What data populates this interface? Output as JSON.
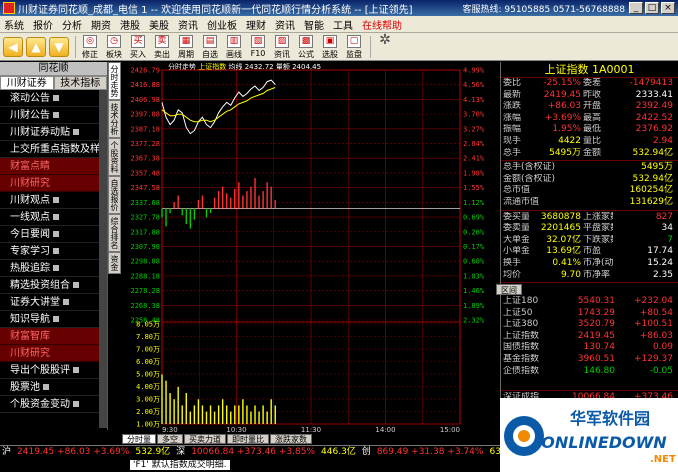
{
  "window": {
    "title": "川财证券同花顺_成都_电信 1 -- 欢迎使用同花顺新一代同花顺行情分析系统 -- [上证领先]",
    "phone": "客服热线: 95105885 0571-56768888"
  },
  "menu": [
    "系统",
    "报价",
    "分析",
    "期资",
    "港股",
    "美股",
    "资讯",
    "创业板",
    "理财",
    "资讯",
    "智能",
    "工具",
    "在线帮助"
  ],
  "toolbar": [
    {
      "icon": "◎",
      "label": "修正"
    },
    {
      "icon": "◷",
      "label": "板块"
    },
    {
      "icon": "买",
      "label": "买入"
    },
    {
      "icon": "卖",
      "label": "卖出"
    },
    {
      "icon": "▦",
      "label": "周期"
    },
    {
      "icon": "▤",
      "label": "自选"
    },
    {
      "icon": "▥",
      "label": "画线"
    },
    {
      "icon": "▧",
      "label": "F10"
    },
    {
      "icon": "▨",
      "label": "资讯"
    },
    {
      "icon": "▩",
      "label": "公式"
    },
    {
      "icon": "▣",
      "label": "选股"
    },
    {
      "icon": "▢",
      "label": "监盘"
    }
  ],
  "left": {
    "header": "同花顺",
    "tabs": [
      "川财证券",
      "技术指标"
    ],
    "items": [
      {
        "text": "滚动公告",
        "dot": true
      },
      {
        "text": "川财公告",
        "dot": true
      },
      {
        "text": "川财证券动贴",
        "dot": true
      },
      {
        "text": "上交所重点指数及样本",
        "dot": false
      }
    ],
    "section1": "财富点睛",
    "section1b": "川财研究",
    "items2": [
      {
        "text": "川财观点",
        "dot": true
      },
      {
        "text": "一线观点",
        "dot": true
      },
      {
        "text": "今日要闻",
        "dot": true
      },
      {
        "text": "专家学习",
        "dot": true
      },
      {
        "text": "热股追踪",
        "dot": true
      },
      {
        "text": "精选投资组合",
        "dot": true
      },
      {
        "text": "证券大讲堂",
        "dot": true
      },
      {
        "text": "知识导航",
        "dot": true
      }
    ],
    "section2": "财富智库",
    "section2b": "川财研究",
    "items3": [
      {
        "text": "导出个股股评",
        "dot": true
      },
      {
        "text": "股票池",
        "dot": true
      },
      {
        "text": "个股资金变动",
        "dot": true
      }
    ]
  },
  "vtabs": [
    "分时走势",
    "技术分析",
    "个股资料",
    "自选报价",
    "综合排名",
    "资金"
  ],
  "chart_data": {
    "type": "line",
    "title": "",
    "header_text": {
      "label": "分时走势",
      "name": "上证指数",
      "price_label": "均线",
      "price": "2432.72",
      "vol_label": "量额",
      "vol": "2404.45"
    },
    "y_ticks_left": [
      "2426.79",
      "2416.88",
      "2406.98",
      "2397.08",
      "2387.18",
      "2377.28",
      "2367.38",
      "2357.48",
      "2347.58",
      "2337.68",
      "2327.78",
      "2317.88",
      "2307.98",
      "2298.08",
      "2288.18",
      "2278.28",
      "2268.38",
      "2258.48"
    ],
    "y_ticks_vol": [
      "8.05万",
      "7.80万",
      "7.00万",
      "6.00万",
      "5.00万",
      "4.00万",
      "3.00万",
      "2.00万",
      "1.00万"
    ],
    "y_ticks_pct": [
      "4.99%",
      "4.56%",
      "4.13%",
      "3.70%",
      "3.27%",
      "2.84%",
      "2.41%",
      "1.98%",
      "1.55%",
      "1.12%",
      "0.69%",
      "0.26%",
      "0.17%",
      "0.60%",
      "1.03%",
      "1.46%",
      "1.89%",
      "2.32%"
    ],
    "x_labels": [
      "9:30",
      "10:30",
      "11:30",
      "14:00",
      "15:00"
    ],
    "base": 2333.41,
    "series": [
      {
        "name": "",
        "x": [
          0,
          1,
          2,
          3,
          4,
          5,
          6,
          7,
          8,
          9,
          10,
          11,
          12,
          13,
          14,
          15,
          16,
          17,
          18,
          19,
          20,
          21,
          22,
          23,
          24,
          25,
          26,
          27,
          28
        ],
        "values": [
          2405,
          2395,
          2390,
          2393,
          2400,
          2398,
          2388,
          2384,
          2386,
          2392,
          2395,
          2390,
          2388,
          2392,
          2398,
          2402,
          2405,
          2403,
          2408,
          2412,
          2409,
          2411,
          2414,
          2416,
          2413,
          2415,
          2419,
          2420,
          2417
        ]
      },
      {
        "name": "",
        "x": [
          0,
          1,
          2,
          3,
          4,
          5,
          6,
          7,
          8,
          9,
          10,
          11,
          12,
          13,
          14,
          15,
          16,
          17,
          18,
          19,
          20,
          21,
          22,
          23,
          24,
          25,
          26,
          27,
          28
        ],
        "values": [
          2400,
          2398,
          2396,
          2396,
          2397,
          2397,
          2395,
          2393,
          2392,
          2392,
          2393,
          2393,
          2392,
          2393,
          2395,
          2397,
          2399,
          2400,
          2402,
          2404,
          2405,
          2406,
          2408,
          2409,
          2410,
          2411,
          2413,
          2414,
          2415
        ]
      }
    ],
    "bars_updown": [
      -4,
      -8,
      -2,
      3,
      6,
      -3,
      -7,
      -9,
      -5,
      4,
      6,
      -4,
      -2,
      5,
      8,
      10,
      7,
      5,
      9,
      12,
      6,
      8,
      10,
      14,
      6,
      8,
      12,
      10,
      4
    ],
    "volume": [
      8,
      7,
      5,
      4,
      6,
      3,
      5,
      2,
      3,
      4,
      3,
      2,
      3,
      2,
      3,
      4,
      3,
      2,
      3,
      3,
      4,
      3,
      2,
      3,
      2,
      3,
      2,
      4,
      3
    ]
  },
  "right": {
    "title": "上证指数 1A0001",
    "rows": [
      {
        "a": "委比",
        "b": "-25.15%",
        "bc": "r",
        "c": "委差",
        "d": "-1479413",
        "dc": "r"
      },
      {
        "a": "最新",
        "b": "2419.45",
        "bc": "r",
        "c": "昨收",
        "d": "2333.41",
        "dc": "w"
      },
      {
        "a": "涨跌",
        "b": "+86.03",
        "bc": "r",
        "c": "开盘",
        "d": "2392.49",
        "dc": "r"
      },
      {
        "a": "涨幅",
        "b": "+3.69%",
        "bc": "r",
        "c": "最高",
        "d": "2422.52",
        "dc": "r"
      },
      {
        "a": "振幅",
        "b": "1.95%",
        "bc": "r",
        "c": "最低",
        "d": "2376.92",
        "dc": "r"
      },
      {
        "a": "现手",
        "b": "4422",
        "bc": "y",
        "c": "量比",
        "d": "2.94",
        "dc": "r"
      },
      {
        "a": "总手",
        "b": "5495万",
        "bc": "y",
        "c": "金额",
        "d": "532.94亿",
        "dc": "y"
      }
    ],
    "rows_b": [
      {
        "a": "总手(含权证)",
        "b": "",
        "c": "5495万",
        "cc": "y"
      },
      {
        "a": "金额(含权证)",
        "b": "",
        "c": "532.94亿",
        "cc": "y"
      },
      {
        "a": "总市值",
        "b": "",
        "c": "160254亿",
        "cc": "y"
      },
      {
        "a": "流通市值",
        "b": "",
        "c": "131629亿",
        "cc": "y"
      }
    ],
    "rows_c": [
      {
        "a": "委买量",
        "b": "3680878",
        "bc": "y",
        "c": "上涨家数",
        "d": "827",
        "dc": "r"
      },
      {
        "a": "委卖量",
        "b": "2201465",
        "bc": "y",
        "c": "平盘家数",
        "d": "34",
        "dc": "w"
      },
      {
        "a": "大单金额",
        "b": "32.07亿",
        "bc": "y",
        "c": "下跌家数",
        "d": "7",
        "dc": "g"
      },
      {
        "a": "小单金额",
        "b": "13.69亿",
        "bc": "y",
        "c": "市盈",
        "d": "17.74",
        "dc": "w"
      },
      {
        "a": "换手",
        "b": "0.41%",
        "bc": "y",
        "c": "市净(动)",
        "d": "15.24",
        "dc": "w"
      },
      {
        "a": "均价",
        "b": "9.70",
        "bc": "y",
        "c": "市净率",
        "d": "2.35",
        "dc": "w"
      }
    ],
    "idx_rows": [
      {
        "a": "上证180",
        "b": "5540.31",
        "c": "+232.04"
      },
      {
        "a": "上证50",
        "b": "1743.29",
        "c": "+80.54"
      },
      {
        "a": "上证380",
        "b": "3520.79",
        "c": "+100.51"
      },
      {
        "a": "上证指数",
        "b": "2419.45",
        "c": "+86.03"
      },
      {
        "a": "国债指数",
        "b": "130.74",
        "c": "0.09"
      },
      {
        "a": "基金指数",
        "b": "3960.51",
        "c": "+129.37"
      },
      {
        "a": "企债指数",
        "b": "146.80",
        "c": "-0.05"
      }
    ],
    "idx_rows2": [
      {
        "a": "深证成指",
        "b": "10066.84",
        "c": "+373.46"
      },
      {
        "a": "成份A指",
        "b": "11038.70",
        "c": "+409.51"
      },
      {
        "a": "成份B指",
        "b": "4444.77",
        "c": "+146.19"
      }
    ],
    "side_btn": "区间"
  },
  "bottom_tabs": [
    "分时量",
    "多空",
    "买卖力道",
    "即时量比",
    "涨跌家数"
  ],
  "status": {
    "line1": [
      {
        "t": "沪",
        "c": "w"
      },
      {
        "t": "2419.45 +86.03 +3.69%",
        "c": "r"
      },
      {
        "t": "532.9亿",
        "c": "y"
      },
      {
        "t": "深",
        "c": "w"
      },
      {
        "t": "10066.84 +373.46 +3.85%",
        "c": "r"
      },
      {
        "t": "446.3亿",
        "c": "y"
      },
      {
        "t": "创",
        "c": "w"
      },
      {
        "t": "869.49 +31.38 +3.74%",
        "c": "r"
      },
      {
        "t": "63.6",
        "c": "y"
      }
    ],
    "line2": "'F1' 默认指数成交明细."
  },
  "watermark": {
    "cn": "华军软件园",
    "en": "ONLINEDOWN",
    "net": ".NET"
  },
  "colors": {
    "up": "#ff3333",
    "down": "#00cc00",
    "grid": "#800000",
    "accent": "#ffff00"
  }
}
